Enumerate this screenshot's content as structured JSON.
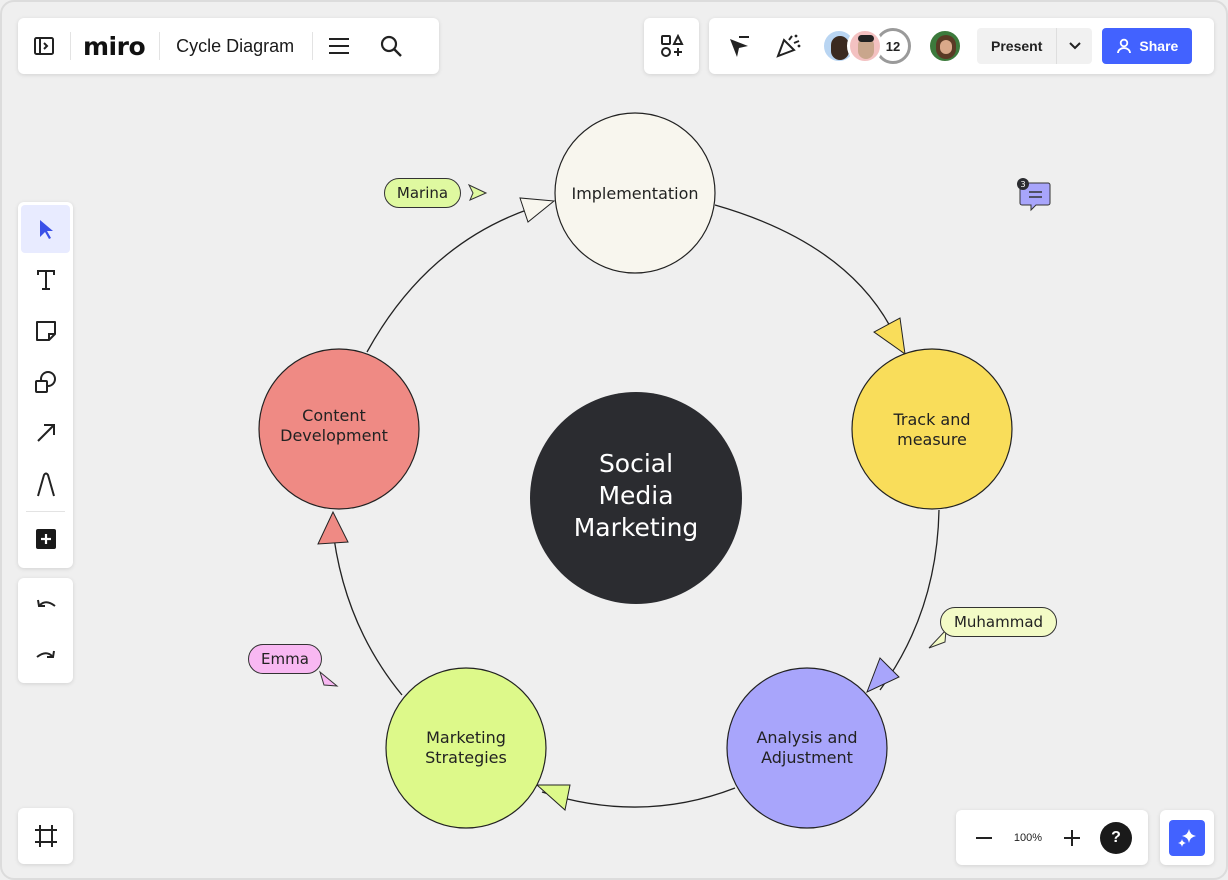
{
  "app": {
    "logo": "miro",
    "board_title": "Cycle Diagram"
  },
  "header": {
    "collaborator_count": "12",
    "present_label": "Present",
    "share_label": "Share"
  },
  "diagram": {
    "center": {
      "lines": [
        "Social",
        "Media",
        "Marketing"
      ],
      "color": "#2b2c30"
    },
    "nodes": [
      {
        "id": "implementation",
        "lines": [
          "Implementation"
        ],
        "color": "#f8f6ee"
      },
      {
        "id": "track-and-measure",
        "lines": [
          "Track and",
          "measure"
        ],
        "color": "#f9dd5a"
      },
      {
        "id": "analysis-and-adjustment",
        "lines": [
          "Analysis and",
          "Adjustment"
        ],
        "color": "#a8a5fb"
      },
      {
        "id": "marketing-strategies",
        "lines": [
          "Marketing",
          "Strategies"
        ],
        "color": "#ddf98a"
      },
      {
        "id": "content-development",
        "lines": [
          "Content",
          "Development"
        ],
        "color": "#ef8a84"
      }
    ]
  },
  "cursors": [
    {
      "name": "Marina",
      "color": "#dff9a0"
    },
    {
      "name": "Muhammad",
      "color": "#f3fbc6"
    },
    {
      "name": "Emma",
      "color": "#f8b8f2"
    }
  ],
  "comment": {
    "count": "3",
    "color": "#a8a5fb"
  },
  "zoom": {
    "level": "100%",
    "minus": "−",
    "plus": "+",
    "help": "?"
  },
  "icons": {
    "sidebar_toggle": "sidebar-toggle-icon",
    "menu": "hamburger-menu-icon",
    "search": "search-icon",
    "apps": "apps-icon",
    "reactions": "cursor-hide-icon",
    "celebrate": "party-popper-icon",
    "select": "select-arrow-icon",
    "text": "text-icon",
    "sticky": "sticky-note-icon",
    "shapes": "shapes-icon",
    "connector": "connector-arrow-icon",
    "pen": "pen-icon",
    "add": "plus-box-icon",
    "undo": "undo-icon",
    "redo": "redo-icon",
    "frames": "frames-icon",
    "ai": "ai-sparkle-icon"
  }
}
